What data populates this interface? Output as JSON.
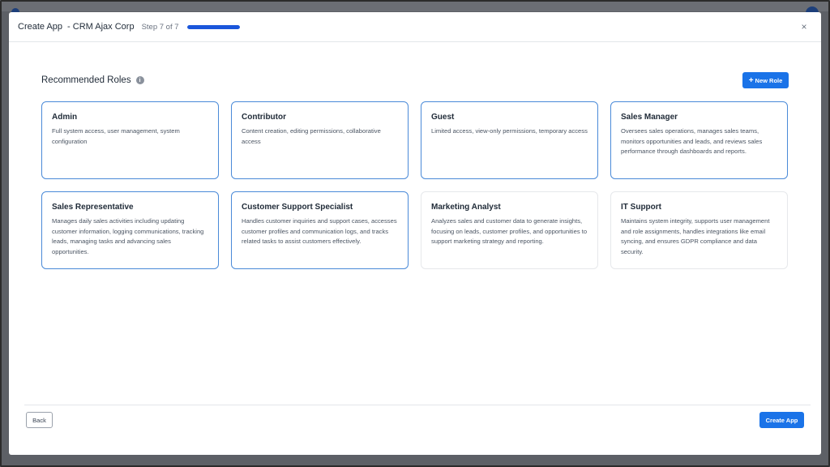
{
  "header": {
    "title": "Create App",
    "subtitle": "- CRM Ajax Corp",
    "step": "Step 7 of 7",
    "progress": 1.0,
    "close_icon": "×"
  },
  "section": {
    "title": "Recommended Roles",
    "info_icon": "i"
  },
  "new_role": {
    "icon": "+",
    "label": "New Role"
  },
  "roles": [
    {
      "title": "Admin",
      "description": "Full system access, user management, system configuration",
      "selected": true
    },
    {
      "title": "Contributor",
      "description": "Content creation, editing permissions, collaborative access",
      "selected": true
    },
    {
      "title": "Guest",
      "description": "Limited access, view-only permissions, temporary access",
      "selected": true
    },
    {
      "title": "Sales Manager",
      "description": "Oversees sales operations, manages sales teams, monitors opportunities and leads, and reviews sales performance through dashboards and reports.",
      "selected": true
    },
    {
      "title": "Sales Representative",
      "description": "Manages daily sales activities including updating customer information, logging communications, tracking leads, managing tasks and advancing sales opportunities.",
      "selected": true
    },
    {
      "title": "Customer Support Specialist",
      "description": "Handles customer inquiries and support cases, accesses customer profiles and communication logs, and tracks related tasks to assist customers effectively.",
      "selected": true
    },
    {
      "title": "Marketing Analyst",
      "description": "Analyzes sales and customer data to generate insights, focusing on leads, customer profiles, and opportunities to support marketing strategy and reporting.",
      "selected": false
    },
    {
      "title": "IT Support",
      "description": "Maintains system integrity, supports user management and role assignments, handles integrations like email syncing, and ensures GDPR compliance and data security.",
      "selected": false
    }
  ],
  "footer": {
    "back_label": "Back",
    "create_label": "Create App"
  },
  "colors": {
    "accent": "#1a73e8",
    "progress": "#1a56db",
    "selected_border": "#4a8ad8"
  }
}
